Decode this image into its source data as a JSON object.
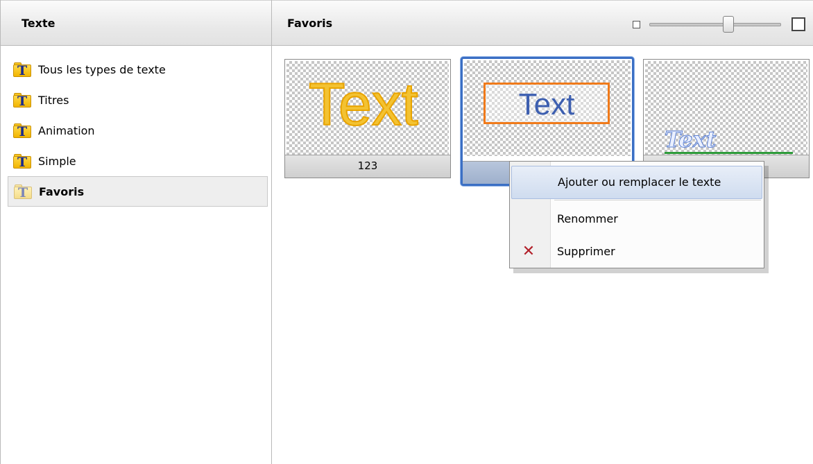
{
  "left_panel": {
    "header": "Texte",
    "items": [
      {
        "label": "Tous les types de texte"
      },
      {
        "label": "Titres"
      },
      {
        "label": "Animation"
      },
      {
        "label": "Simple"
      },
      {
        "label": "Favoris"
      }
    ],
    "icon": "text-folder-icon"
  },
  "right_panel": {
    "header": "Favoris",
    "zoom": {
      "small_icon": "zoom-out-square-icon",
      "big_icon": "zoom-in-square-icon",
      "level": 0.7
    },
    "thumbnails": [
      {
        "caption": "123",
        "sample_text": "Text",
        "selected": false
      },
      {
        "caption": "",
        "sample_text": "Text",
        "selected": true
      },
      {
        "caption": "",
        "sample_text": "Text",
        "selected": false
      }
    ]
  },
  "context_menu": {
    "items": [
      {
        "label": "Ajouter ou remplacer le texte"
      },
      {
        "label": "Renommer"
      },
      {
        "label": "Supprimer",
        "icon": "delete-x-icon"
      }
    ]
  },
  "colors": {
    "selection_border": "#3b6fc4",
    "delete_icon": "#b2202a",
    "folder_yellow": "#f2b500"
  }
}
